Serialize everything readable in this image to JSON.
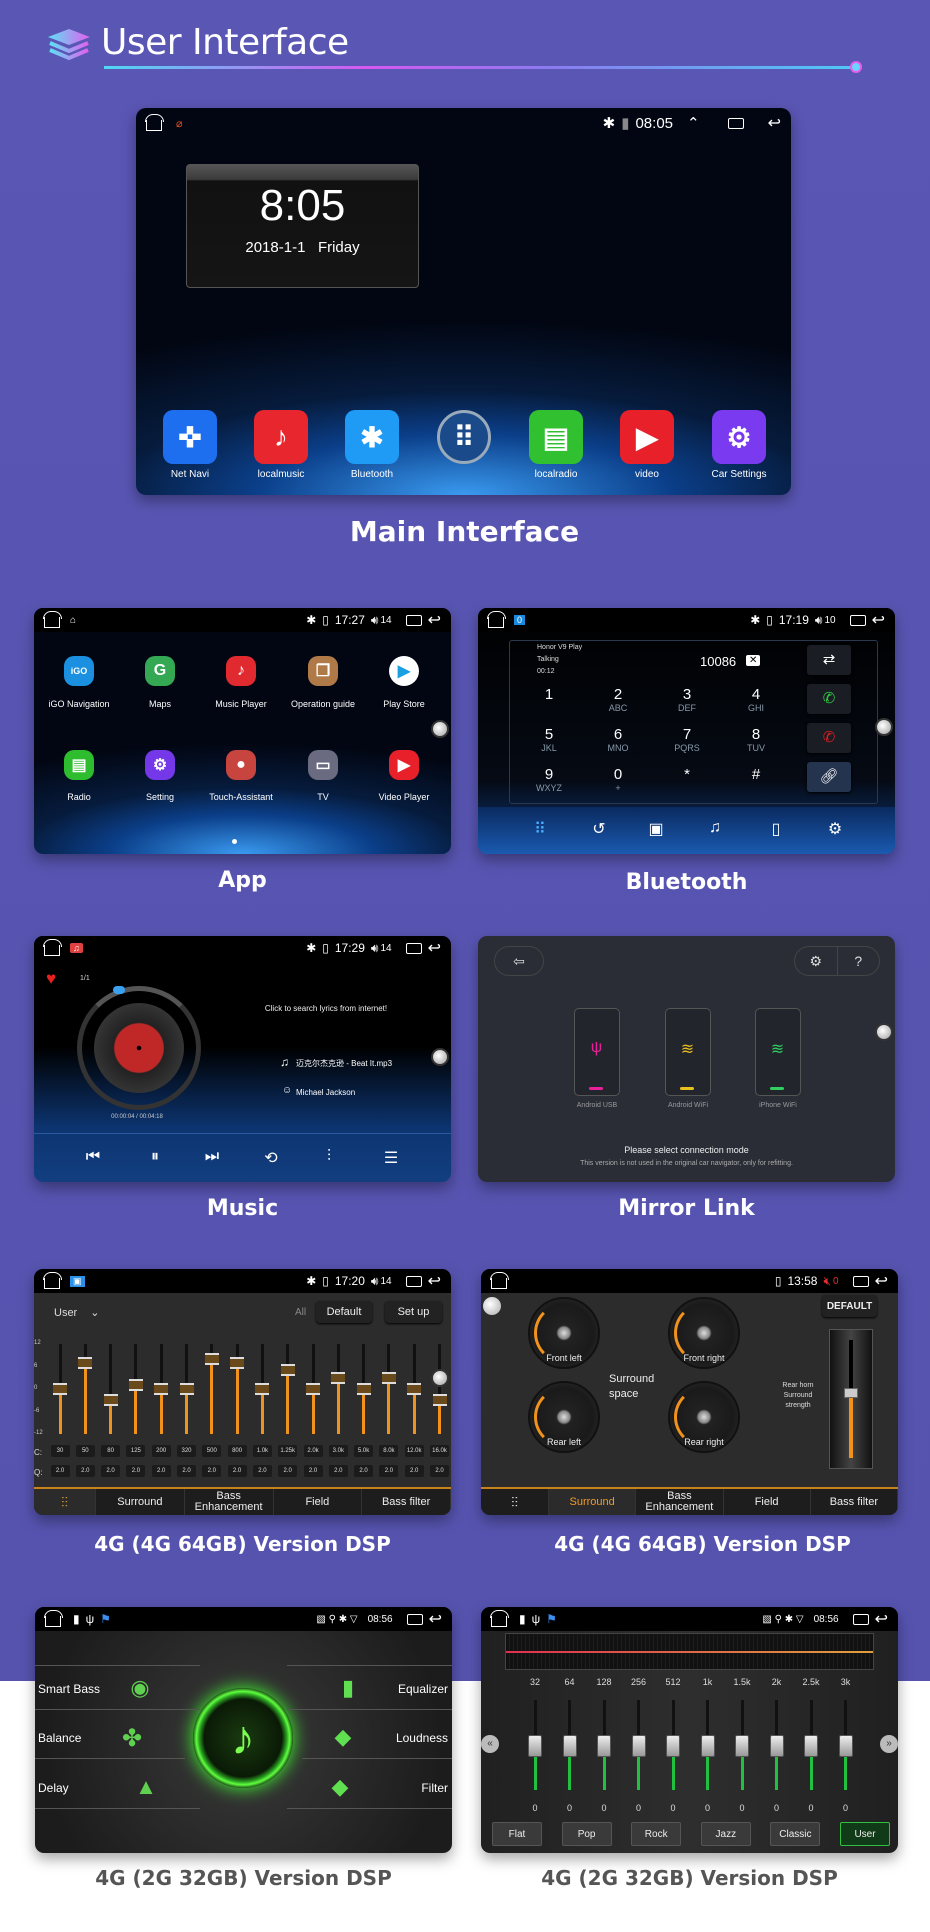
{
  "header": {
    "title": "User Interface",
    "icon": "layers-icon",
    "accent": "#d658f0"
  },
  "main": {
    "caption": "Main Interface",
    "status": {
      "time": "08:05"
    },
    "clock": {
      "time": "8:05",
      "date": "2018-1-1",
      "weekday": "Friday"
    },
    "apps": [
      {
        "label": "Net Navi",
        "icon": "compass-icon",
        "color": "#1e6ff0"
      },
      {
        "label": "localmusic",
        "icon": "music-note-icon",
        "color": "#e8262e"
      },
      {
        "label": "Bluetooth",
        "icon": "bluetooth-icon",
        "color": "#1f9af5"
      },
      {
        "label": "",
        "icon": "app-grid-icon",
        "color": "#1a4a8a"
      },
      {
        "label": "localradio",
        "icon": "radio-icon",
        "color": "#30c030"
      },
      {
        "label": "video",
        "icon": "play-icon",
        "color": "#e8202a"
      },
      {
        "label": "Car Settings",
        "icon": "gear-icon",
        "color": "#7a3af0"
      }
    ]
  },
  "app": {
    "caption": "App",
    "status": {
      "time": "17:27",
      "volume": "14"
    },
    "apps": [
      {
        "label": "iGO Navigation",
        "icon": "igo-icon",
        "color": "#1b8fe0",
        "glyph": "iGO"
      },
      {
        "label": "Maps",
        "icon": "maps-icon",
        "color": "#34a853",
        "glyph": "G"
      },
      {
        "label": "Music Player",
        "icon": "music-note-icon",
        "color": "#e02a30",
        "glyph": "♪"
      },
      {
        "label": "Operation guide",
        "icon": "guide-icon",
        "color": "#b07a48",
        "glyph": "❐"
      },
      {
        "label": "Play Store",
        "icon": "play-store-icon",
        "color": "#ffffff",
        "glyph": "▶"
      },
      {
        "label": "Radio",
        "icon": "radio-icon",
        "color": "#2ebd2e",
        "glyph": "▤"
      },
      {
        "label": "Setting",
        "icon": "gear-icon",
        "color": "#7438e8",
        "glyph": "⚙"
      },
      {
        "label": "Touch-Assistant",
        "icon": "touch-assistant-icon",
        "color": "#c8443e",
        "glyph": "●"
      },
      {
        "label": "TV",
        "icon": "tv-icon",
        "color": "#6a6a80",
        "glyph": "▭"
      },
      {
        "label": "Video Player",
        "icon": "play-icon",
        "color": "#e8202a",
        "glyph": "▶"
      }
    ]
  },
  "bluetooth": {
    "caption": "Bluetooth",
    "status": {
      "time": "17:19",
      "volume": "10"
    },
    "device": "Honor V9 Play",
    "call_state": "Talking",
    "duration": "00:12",
    "number": "10086",
    "keys": [
      {
        "d": "1",
        "l": ""
      },
      {
        "d": "2",
        "l": "ABC"
      },
      {
        "d": "3",
        "l": "DEF"
      },
      {
        "d": "4",
        "l": "GHI"
      },
      {
        "d": "5",
        "l": "JKL"
      },
      {
        "d": "6",
        "l": "MNO"
      },
      {
        "d": "7",
        "l": "PQRS"
      },
      {
        "d": "8",
        "l": "TUV"
      },
      {
        "d": "9",
        "l": "WXYZ"
      },
      {
        "d": "0",
        "l": "+"
      },
      {
        "d": "*",
        "l": ""
      },
      {
        "d": "#",
        "l": ""
      }
    ],
    "side_buttons": [
      "transfer-icon",
      "call-icon",
      "hangup-icon",
      "link-icon"
    ],
    "tabs": [
      "dialpad-icon",
      "call-log-icon",
      "contacts-icon",
      "bt-music-icon",
      "phone-icon",
      "bt-settings-icon"
    ]
  },
  "music": {
    "caption": "Music",
    "status": {
      "time": "17:29",
      "volume": "14"
    },
    "track_index": "1/1",
    "lyrics_prompt": "Click to search lyrics from internet!",
    "song": "迈克尔杰克逊 - Beat It.mp3",
    "artist": "Michael Jackson",
    "time": "00:00:04 / 00:04:18",
    "controls": [
      "previous-icon",
      "pause-icon",
      "next-icon",
      "repeat-icon",
      "equalizer-icon",
      "playlist-icon"
    ]
  },
  "mirror": {
    "caption": "Mirror Link",
    "modes": [
      {
        "label": "Android USB",
        "icon": "usb-icon",
        "color": "#e8209a"
      },
      {
        "label": "Android WiFi",
        "icon": "wifi-icon",
        "color": "#e8c020"
      },
      {
        "label": "iPhone WiFi",
        "icon": "wifi-icon",
        "color": "#30d060"
      }
    ],
    "prompt": "Please select connection mode",
    "note": "This version is not used in the original car navigator, only for refitting."
  },
  "dsp1": {
    "caption": "4G (4G 64GB) Version DSP",
    "status": {
      "time": "17:20",
      "volume": "14"
    },
    "preset": "User",
    "all": "All",
    "default": "Default",
    "setup": "Set up",
    "scale": [
      "12",
      "6",
      "0",
      "-6",
      "-12"
    ],
    "c_label": "C:",
    "q_label": "Q:",
    "bands": [
      "30",
      "50",
      "80",
      "125",
      "200",
      "320",
      "500",
      "800",
      "1.0k",
      "1.25k",
      "2.0k",
      "3.0k",
      "5.0k",
      "8.0k",
      "12.0k",
      "16.0k"
    ],
    "gains_db": [
      0,
      7,
      -3,
      1,
      0,
      0,
      8,
      7,
      0,
      5,
      0,
      3,
      0,
      3,
      0,
      -3
    ],
    "q": [
      "2.0",
      "2.0",
      "2.0",
      "2.0",
      "2.0",
      "2.0",
      "2.0",
      "2.0",
      "2.0",
      "2.0",
      "2.0",
      "2.0",
      "2.0",
      "2.0",
      "2.0",
      "2.0"
    ],
    "tabs": [
      "Surround",
      "Bass Enhancement",
      "Field",
      "Bass filter"
    ],
    "accent": "#f0921c"
  },
  "dsp2": {
    "caption": "4G (4G 64GB) Version DSP",
    "status": {
      "time": "13:58",
      "volume": "0"
    },
    "knobs": [
      "Front left",
      "Front right",
      "Rear left",
      "Rear right"
    ],
    "surround_space": "Surround space",
    "default": "DEFAULT",
    "rear_horn": "Rear horn Surround strength",
    "tabs": [
      "Surround",
      "Bass Enhancement",
      "Field",
      "Bass filter"
    ],
    "active_tab": "Surround"
  },
  "dsp3": {
    "caption": "4G (2G 32GB) Version DSP",
    "status": {
      "time": "08:56"
    },
    "left": [
      "Smart Bass",
      "Balance",
      "Delay"
    ],
    "right": [
      "Equalizer",
      "Loudness",
      "Filter"
    ]
  },
  "dsp4": {
    "caption": "4G (2G 32GB) Version DSP",
    "status": {
      "time": "08:56"
    },
    "bands": [
      "32",
      "64",
      "128",
      "256",
      "512",
      "1k",
      "1.5k",
      "2k",
      "2.5k",
      "3k"
    ],
    "values": [
      "0",
      "0",
      "0",
      "0",
      "0",
      "0",
      "0",
      "0",
      "0",
      "0"
    ],
    "presets": [
      "Flat",
      "Pop",
      "Rock",
      "Jazz",
      "Classic",
      "User"
    ],
    "active_preset": "User"
  }
}
